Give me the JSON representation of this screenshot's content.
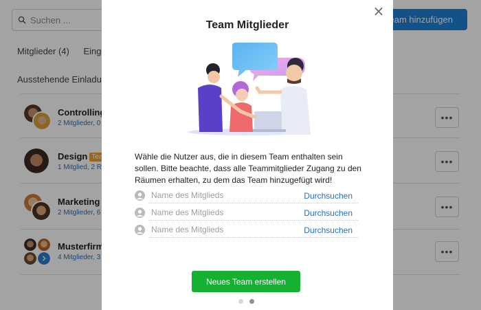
{
  "background": {
    "search": {
      "placeholder": "Suchen ..."
    },
    "add_team_label": "Team hinzufügen",
    "tabs": [
      {
        "label": "Mitglieder (4)"
      },
      {
        "label": "Einges"
      }
    ],
    "pending_label": "Ausstehende Einladung",
    "teams": [
      {
        "name": "Controlling",
        "badge": "",
        "meta": "2 Mitglieder, 0"
      },
      {
        "name": "Design",
        "badge": "Tea",
        "meta": "1 Mitglied, 2 R"
      },
      {
        "name": "Marketing",
        "badge": " ",
        "meta": "2 Mitglieder, 6"
      },
      {
        "name": "Musterfirm",
        "badge": "",
        "meta": "4 Mitglieder, 3"
      }
    ],
    "more_label": "•••"
  },
  "modal": {
    "close_label": "×",
    "title": "Team Mitglieder",
    "description": "Wähle die Nutzer aus, die in diesem Team enthalten sein sollen. Bitte beachte, dass alle Teammitglieder Zugang zu den Räumen erhalten, zu dem das Team hinzugefügt wird!",
    "members": [
      {
        "placeholder": "Name des Mitglieds",
        "link": "Durchsuchen"
      },
      {
        "placeholder": "Name des Mitglieds",
        "link": "Durchsuchen"
      },
      {
        "placeholder": "Name des Mitglieds",
        "link": "Durchsuchen"
      }
    ],
    "create_label": "Neues Team erstellen",
    "pagination": {
      "total": 2,
      "current": 2
    }
  },
  "colors": {
    "primary_blue": "#1e7fd6",
    "create_green": "#16b033",
    "link_blue": "#1e6fc6",
    "badge_orange": "#f0a030",
    "overlay": "rgba(0,0,0,0.36)"
  }
}
